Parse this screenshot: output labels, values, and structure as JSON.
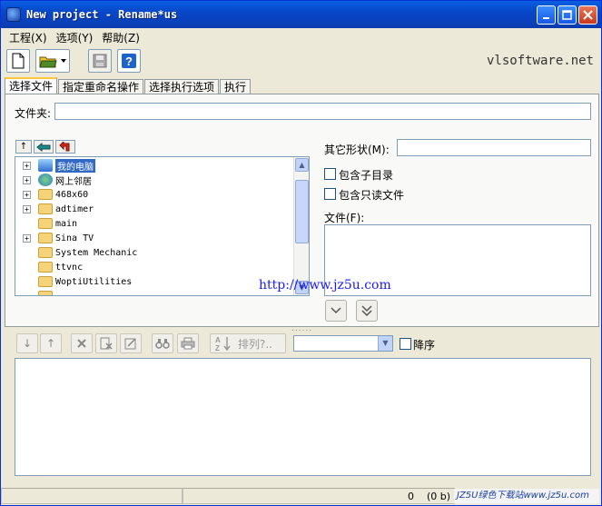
{
  "window": {
    "title": "New project - Rename*us"
  },
  "menu": [
    {
      "label": "工程(X)"
    },
    {
      "label": "选项(Y)"
    },
    {
      "label": "帮助(Z)"
    }
  ],
  "toolbar": {
    "brand": "vlsoftware.net"
  },
  "tabs": [
    "选择文件",
    "指定重命名操作",
    "选择执行选项",
    "执行"
  ],
  "folder": {
    "label": "文件夹:",
    "value": ""
  },
  "nav": {
    "up_glyph": "↑"
  },
  "tree": {
    "items": [
      {
        "label": "我的电脑",
        "icon": "computer-icon",
        "expandable": true,
        "selected": true
      },
      {
        "label": "网上邻居",
        "icon": "network-icon",
        "expandable": true,
        "selected": false
      },
      {
        "label": "468x60",
        "icon": "folder-icon",
        "expandable": true,
        "selected": false
      },
      {
        "label": "adtimer",
        "icon": "folder-icon",
        "expandable": true,
        "selected": false
      },
      {
        "label": "main",
        "icon": "folder-icon",
        "expandable": false,
        "selected": false
      },
      {
        "label": "Sina TV",
        "icon": "folder-icon",
        "expandable": true,
        "selected": false
      },
      {
        "label": "System Mechanic",
        "icon": "folder-icon",
        "expandable": false,
        "selected": false
      },
      {
        "label": "ttvnc",
        "icon": "folder-icon",
        "expandable": false,
        "selected": false
      },
      {
        "label": "WoptiUtilities",
        "icon": "folder-icon",
        "expandable": false,
        "selected": false
      }
    ]
  },
  "filters": {
    "other_shape_label": "其它形状(M):",
    "other_shape_value": "",
    "include_subdirs": "包含子目录",
    "include_readonly": "包含只读文件",
    "files_label": "文件(F):"
  },
  "watermark_url": "http://www.jz5u.com",
  "sort": {
    "label": "排列?..",
    "desc_label": "降序",
    "combo_value": ""
  },
  "status": {
    "count": "0",
    "size": "(0 b)",
    "watermark": "JZ5U绿色下载站www.jz5u.com"
  }
}
